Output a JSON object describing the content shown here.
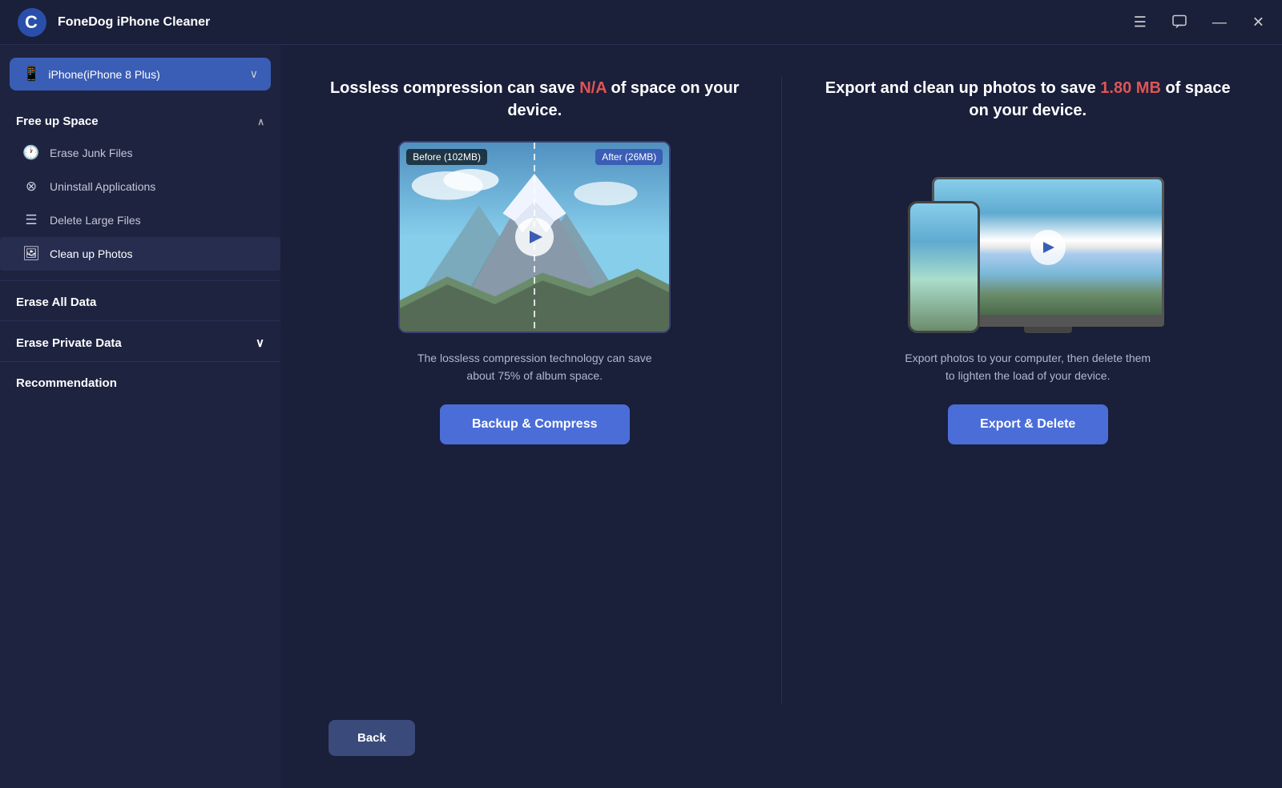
{
  "app": {
    "title": "FoneDog iPhone Cleaner",
    "logo_letter": "C"
  },
  "titlebar": {
    "menu_icon": "☰",
    "chat_icon": "⬜",
    "minimize_icon": "—",
    "close_icon": "✕"
  },
  "device_selector": {
    "label": "iPhone(iPhone 8 Plus)",
    "chevron": "∨"
  },
  "sidebar": {
    "free_up_space": {
      "label": "Free up Space",
      "arrow": "∧",
      "items": [
        {
          "id": "erase-junk",
          "icon": "🕐",
          "label": "Erase Junk Files"
        },
        {
          "id": "uninstall-apps",
          "icon": "⊗",
          "label": "Uninstall Applications"
        },
        {
          "id": "delete-large",
          "icon": "☰",
          "label": "Delete Large Files"
        },
        {
          "id": "clean-photos",
          "icon": "🖼",
          "label": "Clean up Photos"
        }
      ]
    },
    "erase_all_data": {
      "label": "Erase All Data"
    },
    "erase_private_data": {
      "label": "Erase Private Data",
      "arrow": "∨"
    },
    "recommendation": {
      "label": "Recommendation"
    }
  },
  "compress_card": {
    "headline_before": "Lossless compression can save ",
    "headline_highlight": "N/A",
    "headline_after": " of space on your device.",
    "before_label": "Before (102MB)",
    "after_label": "After (26MB)",
    "description": "The lossless compression technology can save about 75% of album space.",
    "button_label": "Backup & Compress"
  },
  "export_card": {
    "headline_before": "Export and clean up photos to save ",
    "headline_highlight": "1.80 MB",
    "headline_after": " of space on your device.",
    "description": "Export photos to your computer, then delete them to lighten the load of your device.",
    "button_label": "Export & Delete"
  },
  "bottom": {
    "back_label": "Back"
  }
}
